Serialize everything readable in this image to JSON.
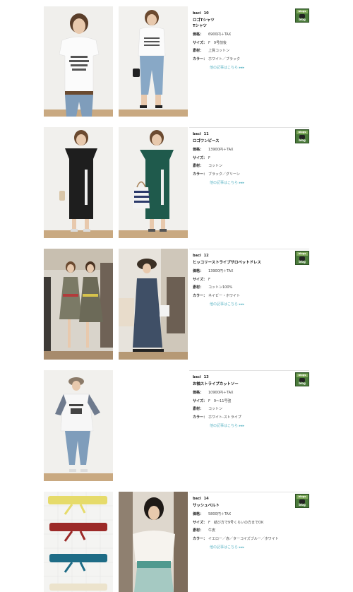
{
  "blog_icon": {
    "top_text": "blogs",
    "label": "blog"
  },
  "products": [
    {
      "brand": "baci",
      "number": "10",
      "name_lines": [
        "ロゴTシャツ",
        "Tシャツ"
      ],
      "specs": [
        {
          "key": "価格：",
          "value": "6900円＋TAX"
        },
        {
          "key": "サイズ：",
          "value": "F　9号前後"
        },
        {
          "key": "素材：",
          "value": "上質コットン"
        },
        {
          "key": "カラー：",
          "value": "ホワイト／ブラック"
        }
      ],
      "more": "他の記事はこちら ▸▸▸",
      "photo_desc": "tshirt"
    },
    {
      "brand": "baci",
      "number": "11",
      "name_lines": [
        "ロゴワンピース"
      ],
      "specs": [
        {
          "key": "価格：",
          "value": "13900円＋TAX"
        },
        {
          "key": "サイズ：",
          "value": "F"
        },
        {
          "key": "素材：",
          "value": "コットン"
        },
        {
          "key": "カラー：",
          "value": "ブラック／グリーン"
        }
      ],
      "more": "他の記事はこちら ▸▸▸",
      "photo_desc": "dress"
    },
    {
      "brand": "baci",
      "number": "12",
      "name_lines": [
        "ヒッコリーストライプサロペットドレス"
      ],
      "specs": [
        {
          "key": "価格：",
          "value": "13900円＋TAX"
        },
        {
          "key": "サイズ：",
          "value": "F"
        },
        {
          "key": "素材：",
          "value": "コットン100%"
        },
        {
          "key": "カラー：",
          "value": "ネイビー・ホワイト"
        }
      ],
      "more": "他の記事はこちら ▸▸▸",
      "photo_desc": "salopette"
    },
    {
      "brand": "baci",
      "number": "13",
      "name_lines": [
        "お袖ストライプカットソー"
      ],
      "specs": [
        {
          "key": "価格：",
          "value": "10900円＋TAX"
        },
        {
          "key": "サイズ：",
          "value": "F　9〜11号強"
        },
        {
          "key": "素材：",
          "value": "コットン"
        },
        {
          "key": "カラー：",
          "value": "ホワイト-ストライプ"
        }
      ],
      "more": "他の記事はこちら ▸▸▸",
      "photo_desc": "cutsew"
    },
    {
      "brand": "baci",
      "number": "14",
      "name_lines": [
        "サッシュベルト"
      ],
      "specs": [
        {
          "key": "価格：",
          "value": "5800円＋TAX"
        },
        {
          "key": "サイズ：",
          "value": "F　結び方で9号くらいの方までOK"
        },
        {
          "key": "素材：",
          "value": "牛皮"
        },
        {
          "key": "カラー：",
          "value": "イエロー／赤／ターコイズブルー／ホワイト"
        }
      ],
      "more": "他の記事はこちら ▸▸▸",
      "photo_desc": "belt"
    }
  ]
}
